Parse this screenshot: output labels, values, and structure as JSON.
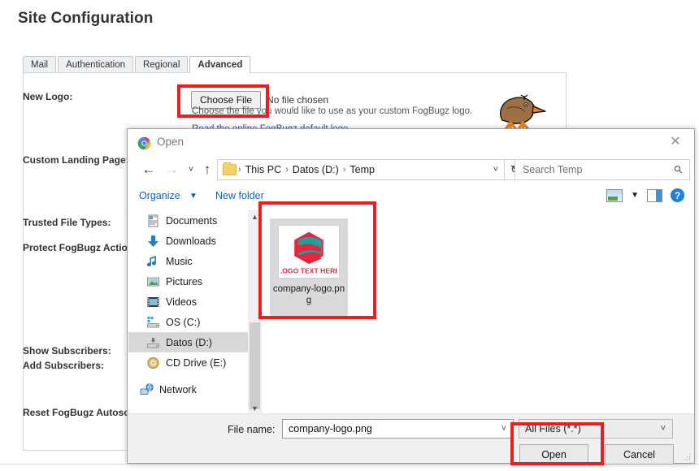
{
  "background": {
    "page_title": "Site Configuration",
    "tabs": [
      {
        "label": "Mail",
        "active": false
      },
      {
        "label": "Authentication",
        "active": false
      },
      {
        "label": "Regional",
        "active": false
      },
      {
        "label": "Advanced",
        "active": true
      }
    ],
    "form_labels": [
      "New Logo:",
      "Custom Landing Page:",
      "Trusted File Types:",
      "Protect FogBugz Actions:",
      "Show Subscribers:",
      "Add Subscribers:",
      "Reset FogBugz Autosort:"
    ],
    "choose_file_button": "Choose File",
    "no_file_chosen": "No file chosen",
    "help_text": "Choose the file you would like to use as your custom FogBugz logo.",
    "link_text": "Read the online FogBugz default logo",
    "kiwi_icon": "kiwi-bird-icon"
  },
  "dialog": {
    "title": "Open",
    "app_icon": "chrome-icon",
    "close_icon": "close-icon",
    "nav": {
      "back_icon": "back-arrow-icon",
      "forward_icon": "forward-arrow-icon",
      "recent_icon": "chevron-down-icon",
      "up_icon": "up-arrow-icon",
      "folder_icon": "folder-icon",
      "breadcrumbs": [
        "This PC",
        "Datos (D:)",
        "Temp"
      ],
      "address_caret": "chevron-down-icon",
      "refresh_icon": "refresh-icon"
    },
    "search": {
      "placeholder": "Search Temp",
      "icon": "search-icon"
    },
    "commandbar": {
      "organize": "Organize",
      "organize_caret": "chevron-down-icon",
      "new_folder": "New folder",
      "view_icon": "view-layout-icon",
      "view_caret": "chevron-down-icon",
      "preview_pane_icon": "preview-pane-icon",
      "help_icon": "help-icon",
      "help_glyph": "?"
    },
    "tree": {
      "items": [
        {
          "label": "Documents",
          "icon": "documents-icon",
          "selected": false
        },
        {
          "label": "Downloads",
          "icon": "downloads-icon",
          "selected": false
        },
        {
          "label": "Music",
          "icon": "music-icon",
          "selected": false
        },
        {
          "label": "Pictures",
          "icon": "pictures-icon",
          "selected": false
        },
        {
          "label": "Videos",
          "icon": "videos-icon",
          "selected": false
        },
        {
          "label": "OS (C:)",
          "icon": "drive-icon",
          "selected": false
        },
        {
          "label": "Datos (D:)",
          "icon": "drive-icon",
          "selected": true
        },
        {
          "label": "CD Drive (E:)",
          "icon": "cd-drive-icon",
          "selected": false
        },
        {
          "label": "Network",
          "icon": "network-icon",
          "selected": false
        }
      ],
      "scroll_up_icon": "chevron-up-icon",
      "scroll_down_icon": "chevron-down-icon"
    },
    "files": [
      {
        "name": "company-logo.png",
        "selected": true,
        "thumbnail_text": "LOGO TEXT HERE",
        "thumbnail_colors": {
          "red": "#e8253f",
          "teal": "#1fa19a"
        }
      }
    ],
    "footer": {
      "file_name_label": "File name:",
      "file_name_value": "company-logo.png",
      "file_name_caret": "chevron-down-icon",
      "file_type_value": "All Files (*.*)",
      "file_type_caret": "chevron-down-icon",
      "open_button": "Open",
      "cancel_button": "Cancel",
      "resize_grip_icon": "resize-grip-icon"
    }
  },
  "annotations": {
    "highlight_color": "#ee1c1c",
    "boxes": [
      {
        "name": "choose-file-highlight"
      },
      {
        "name": "selected-file-highlight"
      },
      {
        "name": "open-button-highlight"
      }
    ]
  }
}
